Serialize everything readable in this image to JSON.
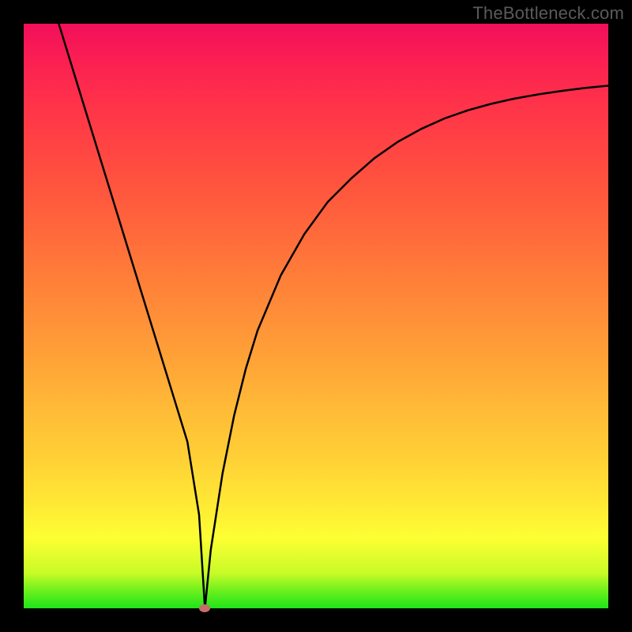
{
  "watermark": "TheBottleneck.com",
  "colors": {
    "frame": "#000000",
    "curve": "#000000",
    "marker": "#c76b6d"
  },
  "chart_data": {
    "type": "line",
    "title": "",
    "xlabel": "",
    "ylabel": "",
    "xlim": [
      0,
      100
    ],
    "ylim": [
      0,
      100
    ],
    "grid": false,
    "series": [
      {
        "name": "bottleneck-curve",
        "x": [
          6,
          8,
          10,
          12,
          14,
          16,
          18,
          20,
          22,
          24,
          26,
          28,
          30,
          31,
          32,
          34,
          36,
          38,
          40,
          44,
          48,
          52,
          56,
          60,
          64,
          68,
          72,
          76,
          80,
          84,
          88,
          92,
          96,
          100
        ],
        "values": [
          100,
          93.5,
          87,
          80.5,
          74,
          67.5,
          61,
          54.5,
          48,
          41.5,
          35,
          28.5,
          16,
          0,
          10,
          23,
          33,
          41,
          47.5,
          57,
          64,
          69.5,
          73.5,
          77,
          79.8,
          82,
          83.8,
          85.2,
          86.3,
          87.2,
          87.9,
          88.5,
          89,
          89.4
        ]
      }
    ],
    "annotations": [
      {
        "name": "optimal-point",
        "x": 31,
        "y": 0
      }
    ]
  }
}
